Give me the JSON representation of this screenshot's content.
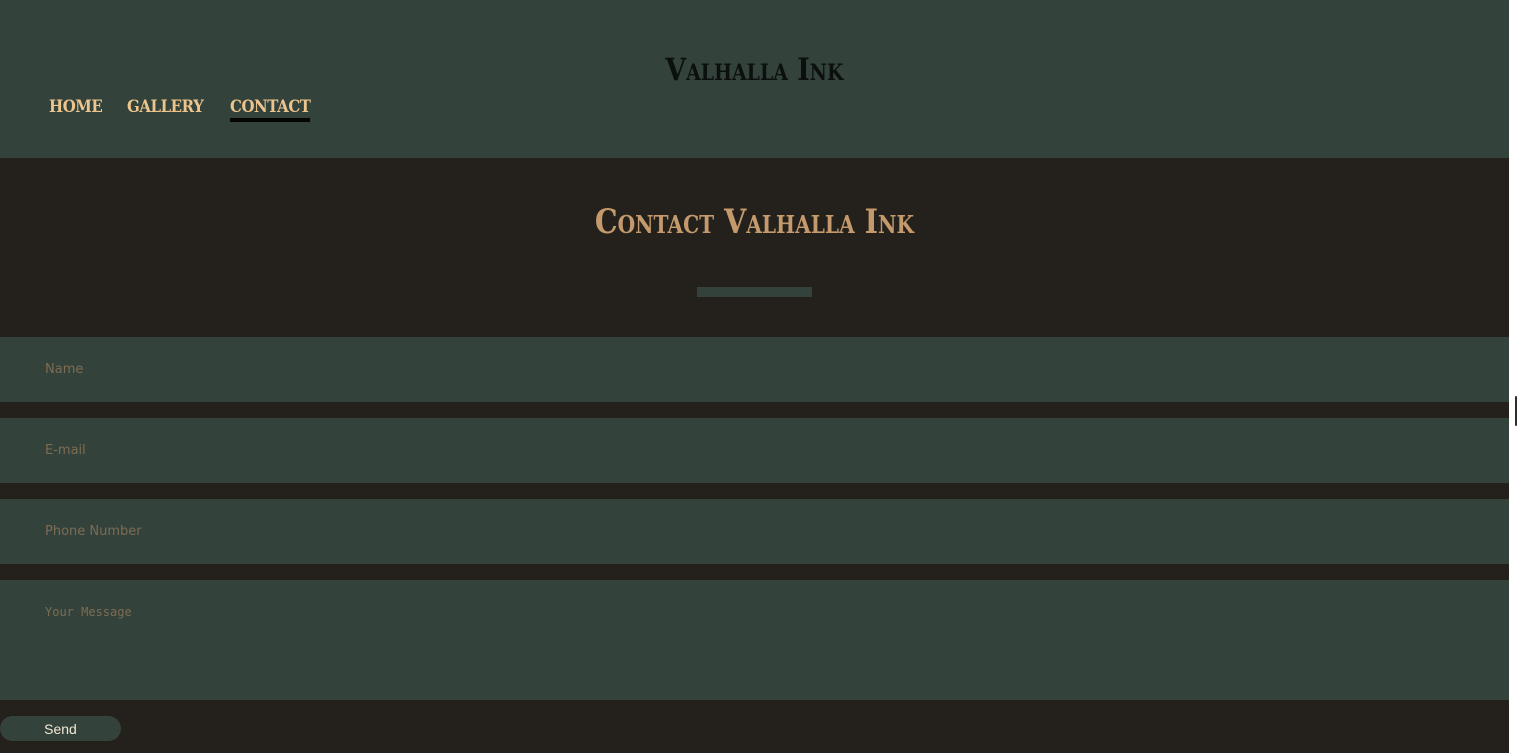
{
  "header": {
    "logo": "Valhalla Ink",
    "nav": [
      {
        "label": "HOME",
        "active": false
      },
      {
        "label": "GALLERY",
        "active": false
      },
      {
        "label": "CONTACT",
        "active": true
      }
    ]
  },
  "hero": {
    "title": "Contact Valhalla Ink"
  },
  "form": {
    "name_placeholder": "Name",
    "email_placeholder": "E-mail",
    "phone_placeholder": "Phone Number",
    "message_placeholder": "Your Message",
    "send_label": "Send"
  },
  "colors": {
    "header_bg": "#33433c",
    "page_bg": "#24211c",
    "nav_text": "#ecc48c",
    "heading_text": "#c49a6c",
    "logo_text": "#0b0f0d"
  }
}
